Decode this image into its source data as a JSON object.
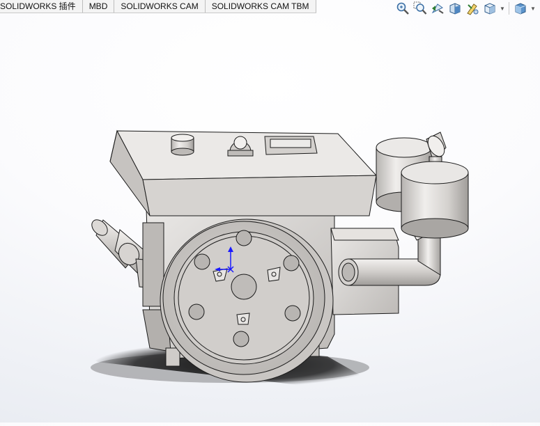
{
  "tabs": [
    {
      "label": "SOLIDWORKS 插件"
    },
    {
      "label": "MBD"
    },
    {
      "label": "SOLIDWORKS CAM"
    },
    {
      "label": "SOLIDWORKS CAM TBM"
    }
  ],
  "view_toolbar": [
    {
      "icon": "zoom-to-fit-icon"
    },
    {
      "icon": "zoom-to-area-icon"
    },
    {
      "icon": "previous-view-icon"
    },
    {
      "icon": "section-view-icon"
    },
    {
      "icon": "dynamic-annotation-icon"
    },
    {
      "icon": "view-orientation-icon"
    },
    {
      "icon": "display-style-icon"
    }
  ],
  "colors": {
    "part_body": "#d2cfcc",
    "part_dark": "#a7a4a1",
    "edge": "#1b1b1b",
    "triad_axis": "#1a1aff"
  }
}
